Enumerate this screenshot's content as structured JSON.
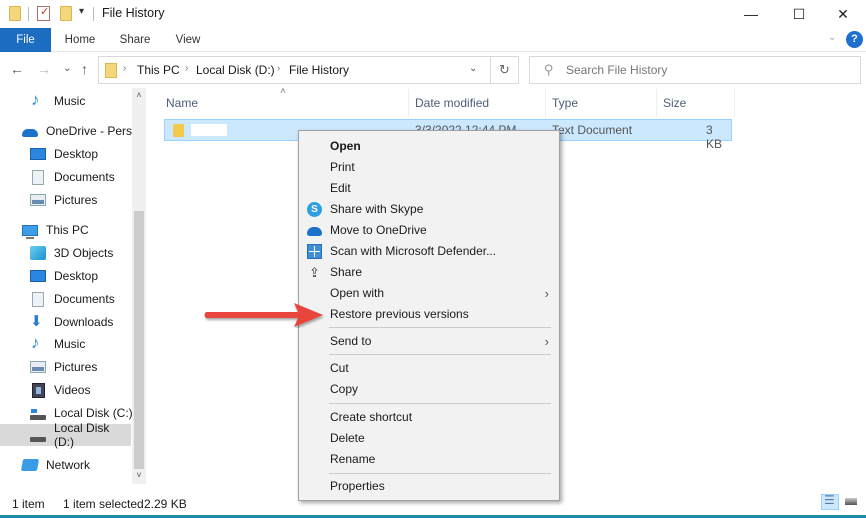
{
  "window": {
    "title": "File History",
    "controls": {
      "minimize": "—",
      "maximize": "☐",
      "close": "✕"
    }
  },
  "ribbon": {
    "tabs": [
      "File",
      "Home",
      "Share",
      "View"
    ],
    "expand_icon": "⌄",
    "help_icon": "?"
  },
  "navigation": {
    "back": "←",
    "forward": "→",
    "recent": "⌄",
    "up": "↑",
    "breadcrumb": [
      "This PC",
      "Local Disk (D:)",
      "File History"
    ],
    "breadcrumb_sep": "›",
    "dropdown": "⌄",
    "refresh": "↻"
  },
  "search": {
    "icon": "⚲",
    "placeholder": "Search File History",
    "value": ""
  },
  "sidebar": {
    "items": [
      {
        "label": "Music",
        "icon": "music-icon",
        "indent": true
      },
      {
        "label": "OneDrive - Persor",
        "icon": "onedrive-icon",
        "indent": false
      },
      {
        "label": "Desktop",
        "icon": "desktop-icon",
        "indent": true
      },
      {
        "label": "Documents",
        "icon": "documents-icon",
        "indent": true
      },
      {
        "label": "Pictures",
        "icon": "pictures-icon",
        "indent": true
      },
      {
        "label": "This PC",
        "icon": "this-pc-icon",
        "indent": false
      },
      {
        "label": "3D Objects",
        "icon": "3d-objects-icon",
        "indent": true
      },
      {
        "label": "Desktop",
        "icon": "desktop-icon",
        "indent": true
      },
      {
        "label": "Documents",
        "icon": "documents-icon",
        "indent": true
      },
      {
        "label": "Downloads",
        "icon": "downloads-icon",
        "indent": true
      },
      {
        "label": "Music",
        "icon": "music-icon",
        "indent": true
      },
      {
        "label": "Pictures",
        "icon": "pictures-icon",
        "indent": true
      },
      {
        "label": "Videos",
        "icon": "videos-icon",
        "indent": true
      },
      {
        "label": "Local Disk (C:)",
        "icon": "local-disk-c-icon",
        "indent": true
      },
      {
        "label": "Local Disk (D:)",
        "icon": "local-disk-d-icon",
        "indent": true,
        "selected": true
      },
      {
        "label": "Network",
        "icon": "network-icon",
        "indent": false
      }
    ],
    "scroll_up": "˄",
    "scroll_down": "˅"
  },
  "file_list": {
    "sort_indicator": "˄",
    "columns": [
      "Name",
      "Date modified",
      "Type",
      "Size"
    ],
    "rows": [
      {
        "name": "",
        "date_modified": "3/3/2022 12:44 PM",
        "type": "Text Document",
        "size": "3 KB",
        "selected": true
      }
    ]
  },
  "context_menu": {
    "items": [
      {
        "label": "Open",
        "bold": true
      },
      {
        "label": "Print"
      },
      {
        "label": "Edit"
      },
      {
        "label": "Share with Skype",
        "icon": "skype-icon",
        "glyph": "S"
      },
      {
        "label": "Move to OneDrive",
        "icon": "onedrive-icon"
      },
      {
        "label": "Scan with Microsoft Defender...",
        "icon": "defender-icon"
      },
      {
        "label": "Share",
        "icon": "share-icon",
        "glyph": "⇪"
      },
      {
        "label": "Open with",
        "submenu": true
      },
      {
        "label": "Restore previous versions"
      },
      {
        "label": "Send to",
        "submenu": true
      },
      {
        "label": "Cut"
      },
      {
        "label": "Copy"
      },
      {
        "label": "Create shortcut"
      },
      {
        "label": "Delete"
      },
      {
        "label": "Rename"
      },
      {
        "label": "Properties"
      }
    ],
    "submenu_arrow": "›"
  },
  "annotation": {
    "arrow_color": "#e8453c",
    "points_to": "Restore previous versions"
  },
  "status_bar": {
    "item_count": "1 item",
    "selection": "1 item selected",
    "selection_size": "2.29 KB"
  },
  "colors": {
    "accent": "#1c6cc2",
    "selection_bg": "#cce8ff",
    "selection_border": "#99d1ff",
    "menu_bg": "#f2f2f2"
  }
}
